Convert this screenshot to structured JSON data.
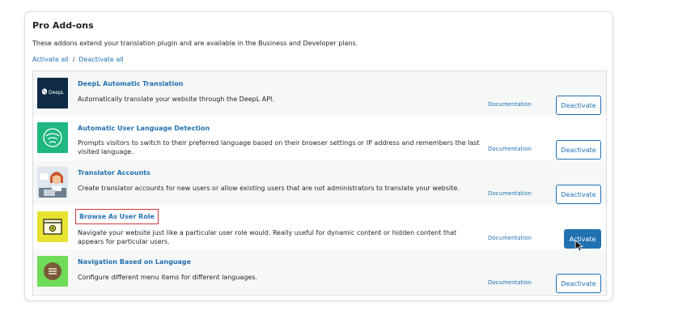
{
  "section": {
    "title": "Pro Add-ons",
    "description": "These addons extend your translation plugin and are available in the Business and Developer plans.",
    "activate_all": "Activate all",
    "separator": "/",
    "deactivate_all": "Deactivate all"
  },
  "addons": [
    {
      "name": "DeepL Automatic Translation",
      "description": "Automatically translate your website through the DeepL API.",
      "documentation": "Documentation",
      "action": "Deactivate",
      "icon": "deepl-logo-icon",
      "logo_text": "DeepL",
      "thumb_color": "#0f2b46"
    },
    {
      "name": "Automatic User Language Detection",
      "description": "Prompts visitors to switch to their preferred language based on their browser settings or IP address and remembers the last visited language.",
      "documentation": "Documentation",
      "action": "Deactivate",
      "icon": "language-detection-icon",
      "thumb_color": "#1fb780"
    },
    {
      "name": "Translator Accounts",
      "description": "Create translator accounts for new users or allow existing users that are not administrators to translate your website.",
      "documentation": "Documentation",
      "action": "Deactivate",
      "icon": "translator-avatar-icon",
      "thumb_color": "#dfe6ec"
    },
    {
      "name": "Browse As User Role",
      "description": "Navigate your website just like a particular user role would. Really useful for dynamic content or hidden content that appears for particular users.",
      "documentation": "Documentation",
      "action": "Activate",
      "icon": "browser-window-icon",
      "thumb_color": "#e7e330"
    },
    {
      "name": "Navigation Based on Language",
      "description": "Configure different menu items for different languages.",
      "documentation": "Documentation",
      "action": "Deactivate",
      "icon": "menu-list-icon",
      "thumb_color": "#6fdc57"
    }
  ],
  "colors": {
    "link": "#2271b1",
    "highlight_border": "#d63638"
  }
}
